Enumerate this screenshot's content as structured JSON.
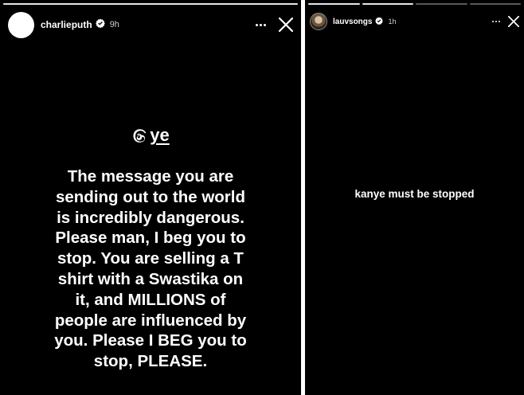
{
  "left_story": {
    "username": "charlieputh",
    "time": "9h",
    "sticker_handle": "ye",
    "message_lines": [
      "The message you are",
      "sending out to the world",
      "is incredibly dangerous.",
      "Please man, I beg you to",
      "stop. You are selling a T",
      "shirt with a Swastika on",
      "it, and MILLIONS of",
      "people are influenced by",
      "you. Please I BEG you to",
      "stop, PLEASE."
    ]
  },
  "right_story": {
    "username": "lauvsongs",
    "time": "1h",
    "message": "kanye must be stopped",
    "progress_segments": 4,
    "progress_current": 2
  },
  "icons": {
    "verified": "verified-badge-icon",
    "more": "more-options-icon",
    "close": "close-icon",
    "threads": "threads-logo-icon"
  },
  "colors": {
    "background": "#000000",
    "text": "#ffffff",
    "divider": "#ffffff"
  }
}
